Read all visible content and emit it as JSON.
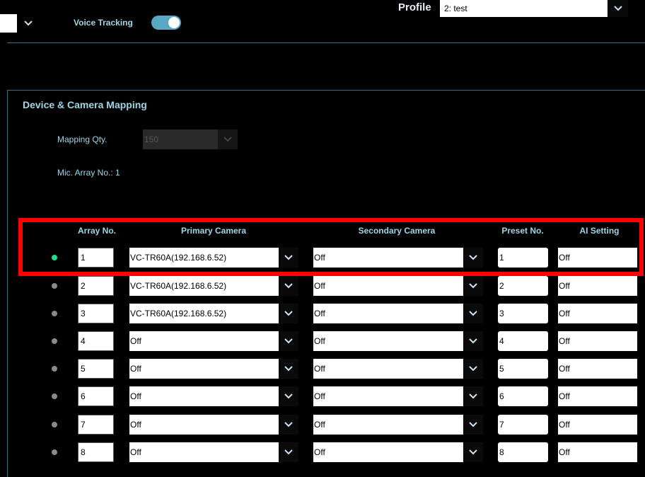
{
  "top": {
    "voice_tracking_label": "Voice Tracking",
    "voice_tracking_on": true,
    "profile_label": "Profile",
    "profile_value": "2: test"
  },
  "section": {
    "title": "Device & Camera Mapping",
    "mapping_qty_label": "Mapping Qty.",
    "mapping_qty_value": "150",
    "mic_array_label": "Mic. Array No.: 1"
  },
  "table": {
    "headers": {
      "array_no": "Array No.",
      "primary": "Primary Camera",
      "secondary": "Secondary Camera",
      "preset": "Preset No.",
      "ai": "AI Setting"
    },
    "rows": [
      {
        "active": true,
        "array": "1",
        "primary": "VC-TR60A(192.168.6.52)",
        "secondary": "Off",
        "preset": "1",
        "ai": "Off"
      },
      {
        "active": false,
        "array": "2",
        "primary": "VC-TR60A(192.168.6.52)",
        "secondary": "Off",
        "preset": "2",
        "ai": "Off"
      },
      {
        "active": false,
        "array": "3",
        "primary": "VC-TR60A(192.168.6.52)",
        "secondary": "Off",
        "preset": "3",
        "ai": "Off"
      },
      {
        "active": false,
        "array": "4",
        "primary": "Off",
        "secondary": "Off",
        "preset": "4",
        "ai": "Off"
      },
      {
        "active": false,
        "array": "5",
        "primary": "Off",
        "secondary": "Off",
        "preset": "5",
        "ai": "Off"
      },
      {
        "active": false,
        "array": "6",
        "primary": "Off",
        "secondary": "Off",
        "preset": "6",
        "ai": "Off"
      },
      {
        "active": false,
        "array": "7",
        "primary": "Off",
        "secondary": "Off",
        "preset": "7",
        "ai": "Off"
      },
      {
        "active": false,
        "array": "8",
        "primary": "Off",
        "secondary": "Off",
        "preset": "8",
        "ai": "Off"
      }
    ]
  },
  "colors": {
    "accent": "#9fd6e6",
    "active_dot": "#19e08c",
    "inactive_dot": "#8a8a8a",
    "highlight": "#ff0000",
    "toggle_track": "#5aa7c4"
  }
}
